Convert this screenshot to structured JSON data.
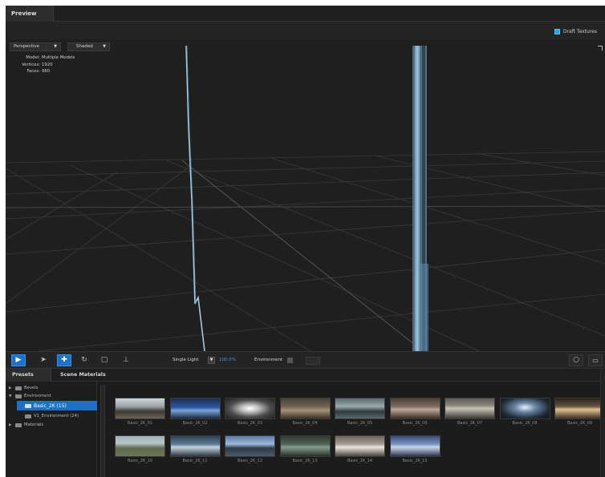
{
  "tabs": {
    "preview": "Preview"
  },
  "header": {
    "draft_textures": "Draft Textures",
    "draft_checked": true
  },
  "viewport": {
    "camera": "Perspective",
    "shading": "Shaded",
    "info": [
      {
        "key": "Model:",
        "value": "Multiple Models"
      },
      {
        "key": "Vertices:",
        "value": "1920"
      },
      {
        "key": "Faces:",
        "value": "960"
      }
    ]
  },
  "toolbar": {
    "light_mode": "Single Light",
    "light_percent": "100.0%",
    "environment_label": "Environment",
    "tools": [
      {
        "name": "camera-icon",
        "glyph": "▶",
        "active": true
      },
      {
        "name": "select-arrow-icon",
        "glyph": "➤",
        "active": false
      },
      {
        "name": "move-icon",
        "glyph": "✚",
        "active": true
      },
      {
        "name": "rotate-icon",
        "glyph": "↻",
        "active": false
      },
      {
        "name": "frame-icon",
        "glyph": "▢",
        "active": false
      },
      {
        "name": "axis-icon",
        "glyph": "⊥",
        "active": false
      }
    ]
  },
  "panel": {
    "tabs": {
      "presets": "Presets",
      "scene_materials": "Scene Materials"
    },
    "tree": [
      {
        "label": "Bevels",
        "expanded": false,
        "selected": false
      },
      {
        "label": "Environment",
        "expanded": true,
        "selected": false
      },
      {
        "label": "Basic_2K (15)",
        "expanded": false,
        "selected": true
      },
      {
        "label": "V1_Environment (24)",
        "expanded": false,
        "selected": false
      },
      {
        "label": "Materials",
        "expanded": false,
        "selected": false
      }
    ],
    "thumbnails": [
      "Basic_2K_01",
      "Basic_2K_02",
      "Basic_2K_03",
      "Basic_2K_04",
      "Basic_2K_05",
      "Basic_2K_06",
      "Basic_2K_07",
      "Basic_2K_08",
      "Basic_2K_09",
      "Basic_2K_10",
      "Basic_2K_11",
      "Basic_2K_12",
      "Basic_2K_13",
      "Basic_2K_14",
      "Basic_2K_15"
    ]
  }
}
